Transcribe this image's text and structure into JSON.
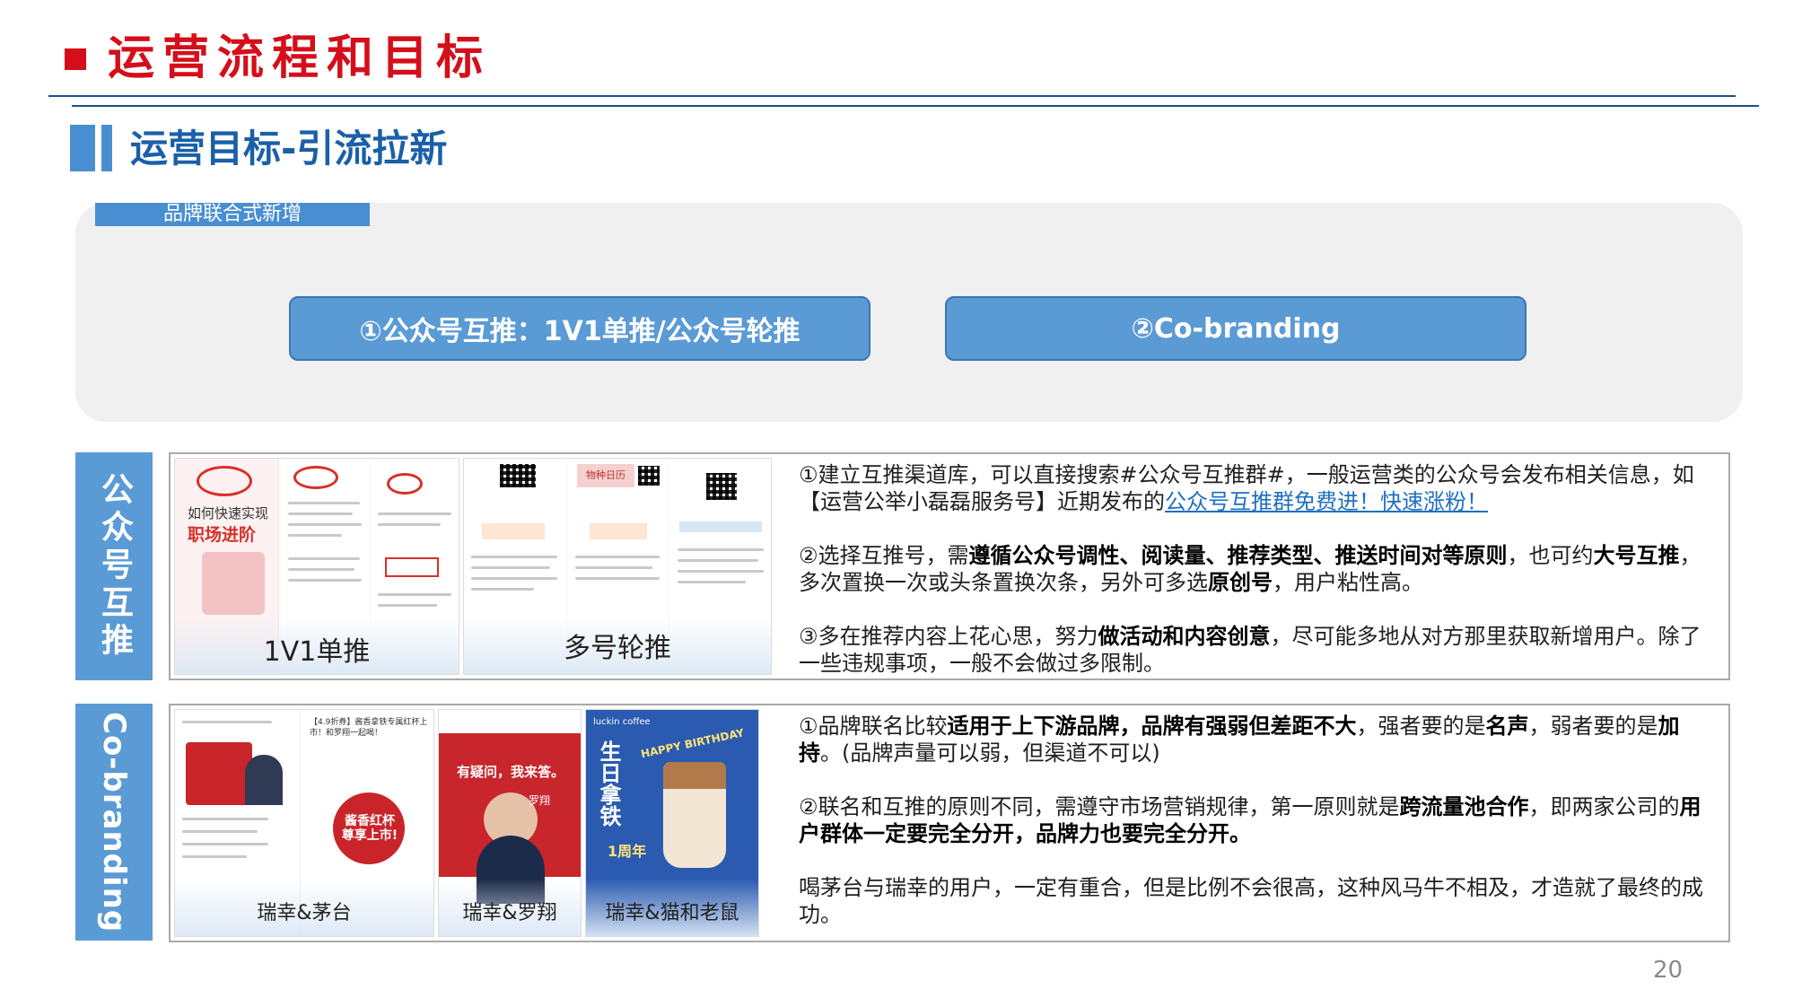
{
  "header": {
    "title": "运营流程和目标",
    "subtitle": "运营目标-引流拉新"
  },
  "panel": {
    "tag": "品牌联合式新增",
    "button1": "①公众号互推：1V1单推/公众号轮推",
    "button2": "②Co-branding"
  },
  "section1": {
    "label": "公众号互推",
    "captions": [
      "1V1单推",
      "多号轮推"
    ],
    "shot_text": {
      "promo_line1": "如何快速实现",
      "promo_line2": "职场进阶",
      "post_title": "物种日历"
    },
    "p1_text": "①建立互推渠道库，可以直接搜索#公众号互推群#，一般运营类的公众号会发布相关信息，如【运营公举小磊磊服务号】近期发布的",
    "p1_link": "公众号互推群免费进！快速涨粉！",
    "p2_a": "②选择互推号，需",
    "p2_b": "遵循公众号调性、阅读量、推荐类型、推送时间对等原则",
    "p2_c": "，也可约",
    "p2_d": "大号互推",
    "p2_e": "，多次置换一次或头条置换次条，另外可多选",
    "p2_f": "原创号",
    "p2_g": "，用户粘性高。",
    "p3_a": "③多在推荐内容上花心思，努力",
    "p3_b": "做活动和内容创意",
    "p3_c": "，尽可能多地从对方那里获取新增用户。除了一些违规事项，一般不会做过多限制。"
  },
  "section2": {
    "label": "Co-branding",
    "captions": [
      "瑞幸&茅台",
      "瑞幸&罗翔",
      "瑞幸&猫和老鼠"
    ],
    "shot_text": {
      "moutai_headline": "【4.9折券】酱香拿铁专属红杯上市！和罗翔一起喝！",
      "moutai_slogan": "酱香红杯 尊享上市!",
      "luoxiang_banner": "有疑问，我来答。",
      "luoxiang_name": "罗翔",
      "tom_vertical": "生日拿铁",
      "tom_ribbon": "HAPPY BIRTHDAY",
      "tom_year": "1周年",
      "brand": "luckin coffee"
    },
    "p1_a": "①品牌联名比较",
    "p1_b": "适用于上下游品牌，品牌有强弱但差距不大",
    "p1_c": "，强者要的是",
    "p1_d": "名声",
    "p1_e": "，弱者要的是",
    "p1_f": "加持",
    "p1_g": "。(品牌声量可以弱，但渠道不可以)",
    "p2_a": "②联名和互推的原则不同，需遵守市场营销规律，第一原则就是",
    "p2_b": "跨流量池合作",
    "p2_c": "，即两家公司的",
    "p2_d": "用户群体一定要完全分开，品牌力也要完全分开。",
    "p3": "喝茅台与瑞幸的用户，一定有重合，但是比例不会很高，这种风马牛不相及，才造就了最终的成功。"
  },
  "footer": {
    "page_number": "20"
  },
  "colors": {
    "title_red": "#d40f1a",
    "accent_blue": "#5b9bd5",
    "subtitle_blue": "#1a5fa8",
    "rule_navy": "#1e4e8c"
  }
}
